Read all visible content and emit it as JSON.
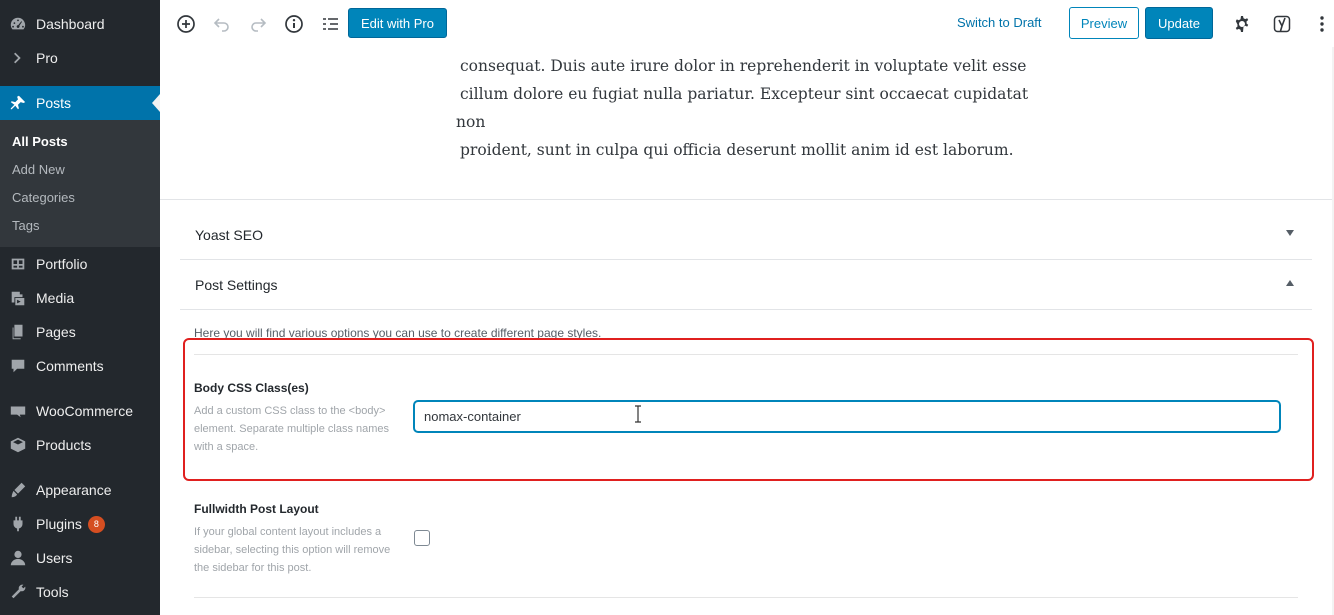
{
  "sidebar": {
    "items": [
      {
        "label": "Dashboard",
        "icon": "dashboard-icon"
      },
      {
        "label": "Pro",
        "icon": "chevron-right-icon"
      },
      {
        "label": "Posts",
        "icon": "pin-icon"
      },
      {
        "label": "Portfolio",
        "icon": "portfolio-icon"
      },
      {
        "label": "Media",
        "icon": "media-icon"
      },
      {
        "label": "Pages",
        "icon": "pages-icon"
      },
      {
        "label": "Comments",
        "icon": "comments-icon"
      },
      {
        "label": "WooCommerce",
        "icon": "woocommerce-icon"
      },
      {
        "label": "Products",
        "icon": "products-icon"
      },
      {
        "label": "Appearance",
        "icon": "appearance-icon"
      },
      {
        "label": "Plugins",
        "icon": "plugins-icon",
        "badge": "8"
      },
      {
        "label": "Users",
        "icon": "users-icon"
      },
      {
        "label": "Tools",
        "icon": "tools-icon"
      }
    ],
    "submenu": [
      "All Posts",
      "Add New",
      "Categories",
      "Tags"
    ]
  },
  "toolbar": {
    "edit_with_pro": "Edit with Pro",
    "switch_to_draft": "Switch to Draft",
    "preview": "Preview",
    "update": "Update"
  },
  "content": {
    "lines": [
      " consequat. Duis aute irure dolor in reprehenderit in voluptate velit esse",
      " cillum dolore eu fugiat nulla pariatur. Excepteur sint occaecat cupidatat",
      "non",
      " proident, sunt in culpa qui officia deserunt mollit anim id est laborum."
    ]
  },
  "panels": {
    "yoast": "Yoast SEO",
    "post_settings": "Post Settings"
  },
  "post_settings": {
    "intro": "Here you will find various options you can use to create different page styles.",
    "body_css": {
      "label": "Body CSS Class(es)",
      "description": "Add a custom CSS class to the <body> element. Separate multiple class names with a space.",
      "value": "nomax-container"
    },
    "fullwidth": {
      "label": "Fullwidth Post Layout",
      "description": "If your global content layout includes a sidebar, selecting this option will remove the sidebar for this post.",
      "checked": false
    }
  },
  "colors": {
    "sidebar_bg": "#23282d",
    "accent": "#0073aa",
    "highlight": "#e0201f"
  }
}
